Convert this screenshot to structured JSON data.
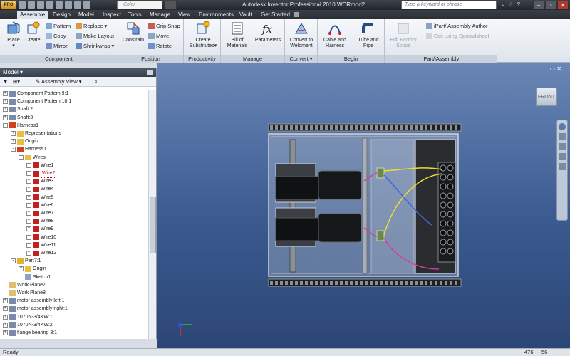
{
  "app": {
    "title": "Autodesk Inventor Professional 2010    WCRmod2",
    "app_button": "PRO",
    "color_box": "Color",
    "search_placeholder": "Type a keyword or phrase"
  },
  "menu": {
    "tabs": [
      "Assemble",
      "Design",
      "Model",
      "Inspect",
      "Tools",
      "Manage",
      "View",
      "Environments",
      "Vault",
      "Get Started"
    ],
    "active": "Assemble"
  },
  "ribbon": {
    "component": {
      "label": "Component",
      "place": "Place",
      "create": "Create",
      "pattern": "Pattern",
      "copy": "Copy",
      "mirror": "Mirror",
      "replace": "Replace",
      "make_layout": "Make Layout",
      "shrinkwrap": "Shrinkwrap"
    },
    "position": {
      "label": "Position",
      "constrain": "Constrain",
      "grip_snap": "Grip Snap",
      "move": "Move",
      "rotate": "Rotate"
    },
    "productivity": {
      "label": "Productivity",
      "create_substitutes_1": "Create",
      "create_substitutes_2": "Substitutes"
    },
    "manage": {
      "label": "Manage",
      "bom_1": "Bill of",
      "bom_2": "Materials",
      "parameters": "Parameters"
    },
    "convert": {
      "label": "Convert",
      "convert_weldment_1": "Convert to",
      "convert_weldment_2": "Weldment"
    },
    "begin": {
      "label": "Begin",
      "cable_harness_1": "Cable and",
      "cable_harness_2": "Harness",
      "tube_pipe_1": "Tube and",
      "tube_pipe_2": "Pipe"
    },
    "edit_factory": {
      "label_1": "Edit Factory",
      "label_2": "Scope"
    },
    "ipart": {
      "label": "iPart/iAssembly",
      "author": "iPart/iAssembly Author",
      "edit_spreadsheet": "Edit using Spreadsheet"
    }
  },
  "browser": {
    "title": "Model",
    "view_label": "Assembly View",
    "items": [
      {
        "label": "Component Pattern 9:1",
        "level": 0,
        "exp": "+"
      },
      {
        "label": "Component Pattern 10:1",
        "level": 0,
        "exp": "+"
      },
      {
        "label": "Shaft:2",
        "level": 0,
        "exp": "+"
      },
      {
        "label": "Shaft:3",
        "level": 0,
        "exp": "+"
      },
      {
        "label": "Harness1",
        "level": 0,
        "exp": "-"
      },
      {
        "label": "Representations",
        "level": 1,
        "exp": "+"
      },
      {
        "label": "Origin",
        "level": 1,
        "exp": "+"
      },
      {
        "label": "Harness1",
        "level": 1,
        "exp": "-"
      },
      {
        "label": "Wires",
        "level": 2,
        "exp": "-"
      },
      {
        "label": "Wire1",
        "level": 3,
        "exp": "+"
      },
      {
        "label": "Wire2",
        "level": 3,
        "exp": "+",
        "selected": true
      },
      {
        "label": "Wire3",
        "level": 3,
        "exp": "+"
      },
      {
        "label": "Wire4",
        "level": 3,
        "exp": "+"
      },
      {
        "label": "Wire5",
        "level": 3,
        "exp": "+"
      },
      {
        "label": "Wire6",
        "level": 3,
        "exp": "+"
      },
      {
        "label": "Wire7",
        "level": 3,
        "exp": "+"
      },
      {
        "label": "Wire8",
        "level": 3,
        "exp": "+"
      },
      {
        "label": "Wire9",
        "level": 3,
        "exp": "+"
      },
      {
        "label": "Wire10",
        "level": 3,
        "exp": "+"
      },
      {
        "label": "Wire11",
        "level": 3,
        "exp": "+"
      },
      {
        "label": "Wire12",
        "level": 3,
        "exp": "+"
      },
      {
        "label": "Part7:1",
        "level": 1,
        "exp": "-"
      },
      {
        "label": "Origin",
        "level": 2,
        "exp": "+"
      },
      {
        "label": "Sketch1",
        "level": 2,
        "exp": ""
      },
      {
        "label": "Work Plane7",
        "level": 0,
        "exp": ""
      },
      {
        "label": "Work Plane8",
        "level": 0,
        "exp": ""
      },
      {
        "label": "motor assembly left:1",
        "level": 0,
        "exp": "+"
      },
      {
        "label": "motor assembly right:1",
        "level": 0,
        "exp": "+"
      },
      {
        "label": "1070N-3/4KW:1",
        "level": 0,
        "exp": "+"
      },
      {
        "label": "1070N-3/4KW:2",
        "level": 0,
        "exp": "+"
      },
      {
        "label": "flange bearing 3:1",
        "level": 0,
        "exp": "+"
      }
    ]
  },
  "viewport": {
    "viewcube_label": "FRONT"
  },
  "status": {
    "text": "Ready",
    "count1": "476",
    "count2": "56"
  },
  "colors": {
    "wire_yellow": "#e8e030",
    "wire_blue": "#4060e0",
    "wire_magenta": "#d040a0",
    "viewport_top": "#6a86b6",
    "viewport_bottom": "#2c4676"
  }
}
